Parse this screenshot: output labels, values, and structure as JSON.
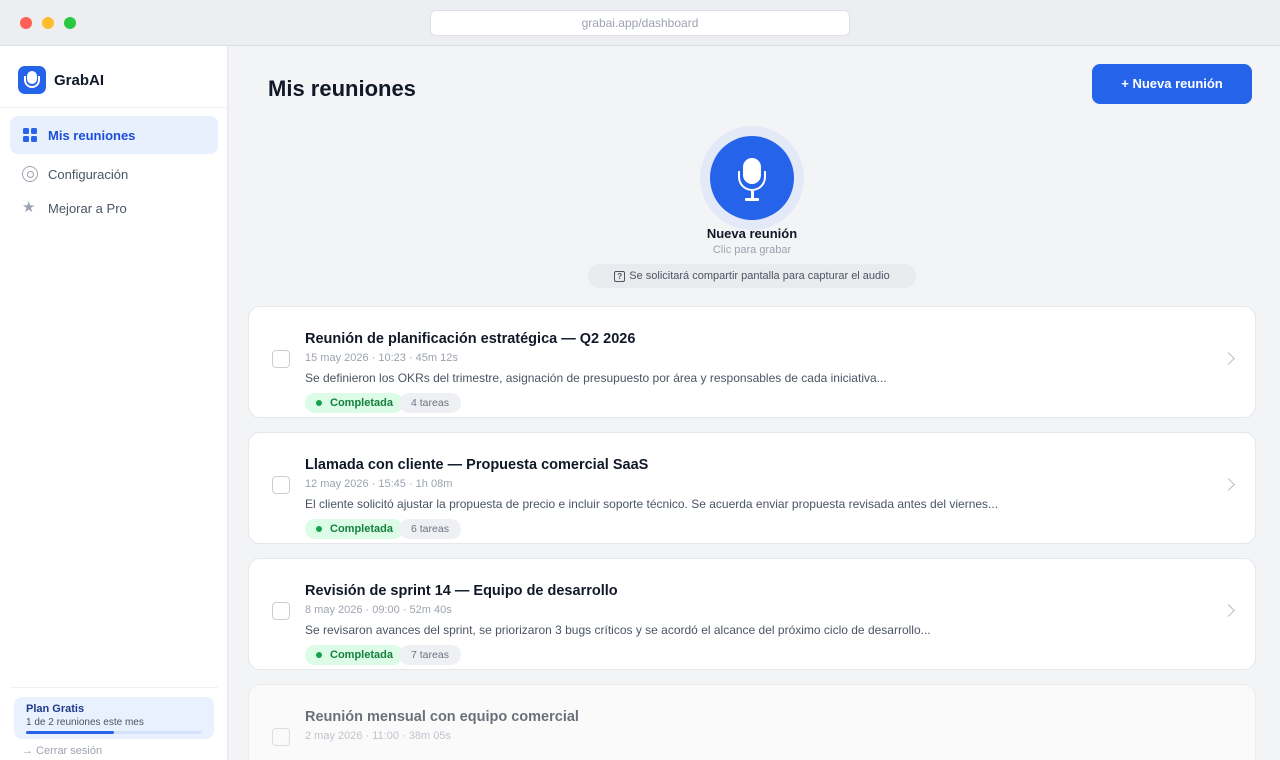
{
  "browser": {
    "url": "grabai.app/dashboard"
  },
  "sidebar": {
    "brand": "GrabAI",
    "items": [
      {
        "label": "Mis reuniones",
        "icon": "grid-icon",
        "active": true
      },
      {
        "label": "Configuración",
        "icon": "gear-icon",
        "active": false
      },
      {
        "label": "Mejorar a Pro",
        "icon": "star-icon",
        "active": false
      }
    ],
    "plan": {
      "title": "Plan Gratis",
      "usage": "1 de 2 reuniones este mes",
      "used": 1,
      "limit": 2
    },
    "logout": "→ Cerrar sesión"
  },
  "main": {
    "title": "Mis reuniones",
    "new_button": "+ Nueva reunión",
    "record": {
      "label": "Nueva reunión",
      "sub": "Clic para grabar",
      "note": "Se solicitará compartir pantalla para capturar el audio"
    },
    "meetings": [
      {
        "title": "Reunión de planificación estratégica — Q2 2026",
        "meta": "15 may 2026 · 10:23 · 45m 12s",
        "summary": "Se definieron los OKRs del trimestre, asignación de presupuesto por área y responsables de cada iniciativa...",
        "status": "Completada",
        "tasks": "4 tareas"
      },
      {
        "title": "Llamada con cliente — Propuesta comercial SaaS",
        "meta": "12 may 2026 · 15:45 · 1h 08m",
        "summary": "El cliente solicitó ajustar la propuesta de precio e incluir soporte técnico. Se acuerda enviar propuesta revisada antes del viernes...",
        "status": "Completada",
        "tasks": "6 tareas"
      },
      {
        "title": "Revisión de sprint 14 — Equipo de desarrollo",
        "meta": "8 may 2026 · 09:00 · 52m 40s",
        "summary": "Se revisaron avances del sprint, se priorizaron 3 bugs críticos y se acordó el alcance del próximo ciclo de desarrollo...",
        "status": "Completada",
        "tasks": "7 tareas"
      },
      {
        "title": "Reunión mensual con equipo comercial",
        "meta": "2 may 2026 · 11:00 · 38m 05s"
      }
    ]
  },
  "colors": {
    "accent": "#2563eb",
    "success": "#16a34a",
    "success_bg": "#dcfce7"
  }
}
